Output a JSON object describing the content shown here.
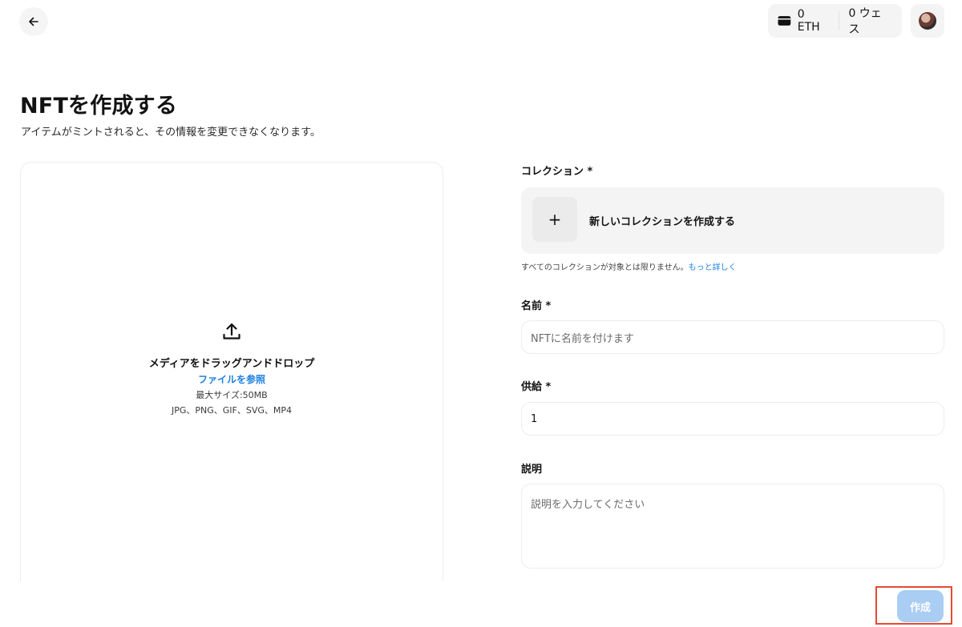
{
  "header": {
    "back_icon": "arrow-left-icon",
    "wallet_icon": "wallet-icon",
    "eth_balance": "0 ETH",
    "weth_balance": "0 ウェス",
    "avatar_icon": "profile-avatar"
  },
  "page": {
    "title": "NFTを作成する",
    "subtitle": "アイテムがミントされると、その情報を変更できなくなります。"
  },
  "upload": {
    "icon": "upload-icon",
    "title": "メディアをドラッグアンドドロップ",
    "browse_link": "ファイルを参照",
    "max_size": "最大サイズ:50MB",
    "file_types": "JPG、PNG、GIF、SVG、MP4"
  },
  "form": {
    "collection_label": "コレクション *",
    "collection_plus": "+",
    "collection_create": "新しいコレクションを作成する",
    "collection_hint": "すべてのコレクションが対象とは限りません。",
    "collection_hint_link": "もっと詳しく",
    "name_label": "名前 *",
    "name_placeholder": "NFTに名前を付けます",
    "supply_label": "供給 *",
    "supply_value": "1",
    "description_label": "説明",
    "description_placeholder": "説明を入力してください"
  },
  "footer": {
    "create_button": "作成"
  },
  "colors": {
    "accent": "#2081e2",
    "button_disabled": "#a9cdf3",
    "highlight": "#e34b32"
  }
}
